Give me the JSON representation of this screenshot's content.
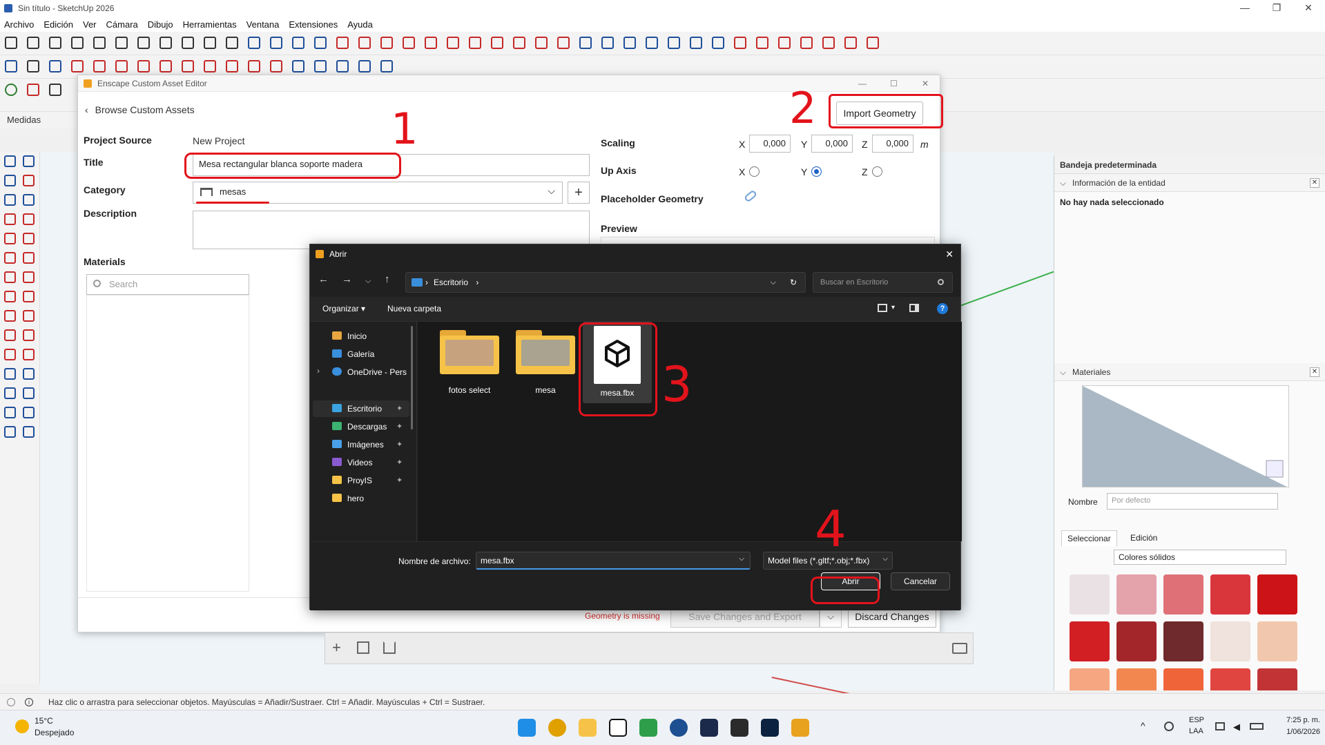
{
  "window": {
    "title": "Sin título - SketchUp 2026",
    "min": "—",
    "max": "❐",
    "close": "✕"
  },
  "menu": [
    "Archivo",
    "Edición",
    "Ver",
    "Cámara",
    "Dibujo",
    "Herramientas",
    "Ventana",
    "Extensiones",
    "Ayuda"
  ],
  "measures_label": "Medidas",
  "editor": {
    "window_title": "Enscape Custom Asset Editor",
    "back_label": "Browse Custom Assets",
    "import_button": "Import Geometry",
    "project_source_label": "Project Source",
    "project_source_value": "New Project",
    "title_label": "Title",
    "title_value": "Mesa rectangular blanca soporte madera",
    "category_label": "Category",
    "category_value": "mesas",
    "description_label": "Description",
    "materials_label": "Materials",
    "materials_search_placeholder": "Search",
    "scaling_label": "Scaling",
    "scale": {
      "x_label": "X",
      "x": "0,000",
      "y_label": "Y",
      "y": "0,000",
      "z_label": "Z",
      "z": "0,000",
      "unit": "m"
    },
    "up_axis_label": "Up Axis",
    "up_axis": {
      "x": "X",
      "y": "Y",
      "z": "Z",
      "selected": "Y"
    },
    "placeholder_label": "Placeholder Geometry",
    "preview_label": "Preview",
    "geometry_missing": "Geometry is missing",
    "save_export_button": "Save Changes and Export",
    "discard_button": "Discard Changes"
  },
  "annotations": {
    "n1": "1",
    "n2": "2",
    "n3": "3",
    "n4": "4",
    "color": "#e3131b"
  },
  "open_dialog": {
    "title": "Abrir",
    "path": [
      "Escritorio"
    ],
    "search_placeholder": "Buscar en Escritorio",
    "organize": "Organizar",
    "new_folder": "Nueva carpeta",
    "sidebar": [
      {
        "label": "Inicio",
        "icon": "home-icon",
        "pinned": false
      },
      {
        "label": "Galería",
        "icon": "gallery-icon",
        "pinned": false
      },
      {
        "label": "OneDrive - Pers",
        "icon": "cloud-icon",
        "pinned": false
      },
      {
        "label": "Escritorio",
        "icon": "desktop-icon",
        "pinned": true
      },
      {
        "label": "Descargas",
        "icon": "download-icon",
        "pinned": true
      },
      {
        "label": "Imágenes",
        "icon": "pictures-icon",
        "pinned": true
      },
      {
        "label": "Videos",
        "icon": "video-icon",
        "pinned": true
      },
      {
        "label": "ProyIS",
        "icon": "folder-icon",
        "pinned": true
      },
      {
        "label": "hero",
        "icon": "folder-icon",
        "pinned": false
      }
    ],
    "files": [
      {
        "name": "fotos select",
        "type": "folder"
      },
      {
        "name": "mesa",
        "type": "folder"
      },
      {
        "name": "mesa.fbx",
        "type": "model",
        "selected": true
      }
    ],
    "filename_label": "Nombre de archivo:",
    "filename_value": "mesa.fbx",
    "filter_value": "Model files (*.gltf;*.obj;*.fbx)",
    "open_button": "Abrir",
    "cancel_button": "Cancelar"
  },
  "tray": {
    "title": "Bandeja predeterminada",
    "entity_section": "Información de la entidad",
    "entity_status": "No hay nada seleccionado",
    "materials_section": "Materiales",
    "name_label": "Nombre",
    "name_placeholder": "Por defecto",
    "tab_select": "Seleccionar",
    "tab_edit": "Edición",
    "library": "Colores sólidos",
    "swatches": [
      "#e9e1e3",
      "#e4a2ab",
      "#e07077",
      "#d9363c",
      "#cc1418",
      "#d21f24",
      "#a3262b",
      "#6e2a2c",
      "#f0e2dc",
      "#f1c8ad",
      "#f6a680",
      "#f2874f",
      "#f0643a",
      "#e0463f",
      "#c23335"
    ]
  },
  "status_bar": "Haz clic o arrastra para seleccionar objetos. Mayúsculas = Añadir/Sustraer. Ctrl = Añadir. Mayúsculas + Ctrl = Sustraer.",
  "taskbar": {
    "weather_temp": "15°C",
    "weather_desc": "Despejado",
    "lang_1": "ESP",
    "lang_2": "LAA",
    "time": "7:25 p. m.",
    "date": "1/06/2026"
  }
}
